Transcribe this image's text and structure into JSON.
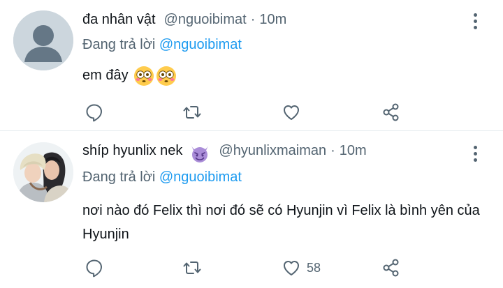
{
  "tweets": [
    {
      "name": "đa nhân vật",
      "handle": "@nguoibimat",
      "time": "10m",
      "replying_prefix": "Đang trả lời",
      "replying_to": "@nguoibimat",
      "text": "em đây",
      "likes": ""
    },
    {
      "name": "shíp hyunlix nek",
      "handle": "@hyunlixmaiman",
      "time": "10m",
      "replying_prefix": "Đang trả lời",
      "replying_to": "@nguoibimat",
      "text": "nơi nào đó Felix thì nơi đó sẽ có Hyunjin vì Felix là bình yên của Hyunjin",
      "likes": "58"
    }
  ],
  "icons": {
    "reply": "reply-icon",
    "retweet": "retweet-icon",
    "like": "heart-icon",
    "share": "share-icon",
    "more": "more-vertical-icon"
  },
  "colors": {
    "text": "#0f1419",
    "secondary": "#536471",
    "mention": "#1d9bf0",
    "divider": "#e6ecf0"
  }
}
